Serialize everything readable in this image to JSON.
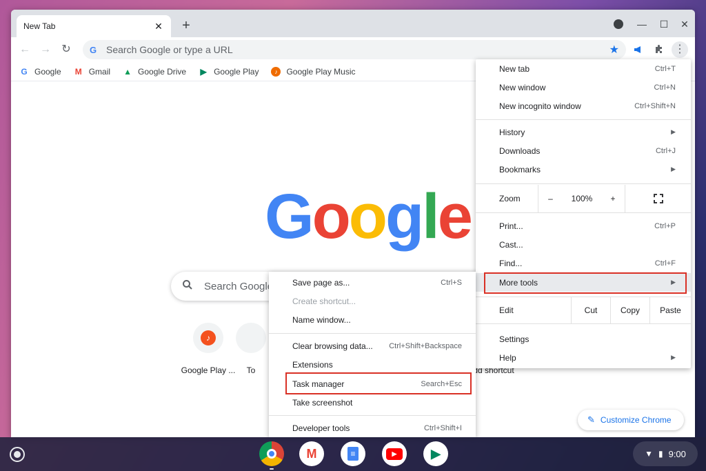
{
  "tab": {
    "title": "New Tab",
    "close": "✕"
  },
  "toolbar": {
    "new_tab": "+",
    "back": "←",
    "forward": "→",
    "reload": "↻",
    "omnibox_placeholder": "Search Google or type a URL",
    "star": "★",
    "announce": "📣",
    "extensions": "✚",
    "menu": "⋮"
  },
  "window_controls": {
    "minimize": "—",
    "maximize": "☐",
    "close": "✕"
  },
  "bookmarks": [
    {
      "label": "Google",
      "icon": "G",
      "color": "#4285f4"
    },
    {
      "label": "Gmail",
      "icon": "M",
      "color": "#ea4335"
    },
    {
      "label": "Google Drive",
      "icon": "▲",
      "color": "#0f9d58"
    },
    {
      "label": "Google Play",
      "icon": "▶",
      "color": "#01875f"
    },
    {
      "label": "Google Play Music",
      "icon": "♪",
      "color": "#ef6c00"
    }
  ],
  "ntp": {
    "logo": [
      "G",
      "o",
      "o",
      "g",
      "l",
      "e"
    ],
    "logo_colors": [
      "#4285f4",
      "#ea4335",
      "#fbbc05",
      "#4285f4",
      "#34a853",
      "#ea4335"
    ],
    "search_placeholder": "Search Google",
    "shortcuts": [
      {
        "label": "Google Play ..."
      },
      {
        "label": "To"
      },
      {
        "label": "Add shortcut"
      }
    ],
    "customize": "Customize Chrome"
  },
  "main_menu": {
    "new_tab": {
      "label": "New tab",
      "shortcut": "Ctrl+T"
    },
    "new_window": {
      "label": "New window",
      "shortcut": "Ctrl+N"
    },
    "incognito": {
      "label": "New incognito window",
      "shortcut": "Ctrl+Shift+N"
    },
    "history": {
      "label": "History"
    },
    "downloads": {
      "label": "Downloads",
      "shortcut": "Ctrl+J"
    },
    "bookmarks": {
      "label": "Bookmarks"
    },
    "zoom": {
      "label": "Zoom",
      "minus": "–",
      "level": "100%",
      "plus": "+",
      "fullscreen": "⛶"
    },
    "print": {
      "label": "Print...",
      "shortcut": "Ctrl+P"
    },
    "cast": {
      "label": "Cast..."
    },
    "find": {
      "label": "Find...",
      "shortcut": "Ctrl+F"
    },
    "more_tools": {
      "label": "More tools"
    },
    "edit": {
      "label": "Edit",
      "cut": "Cut",
      "copy": "Copy",
      "paste": "Paste"
    },
    "settings": {
      "label": "Settings"
    },
    "help": {
      "label": "Help"
    },
    "arrow": "▶"
  },
  "sub_menu": {
    "save_page": {
      "label": "Save page as...",
      "shortcut": "Ctrl+S"
    },
    "create_shortcut": {
      "label": "Create shortcut..."
    },
    "name_window": {
      "label": "Name window..."
    },
    "clear_data": {
      "label": "Clear browsing data...",
      "shortcut": "Ctrl+Shift+Backspace"
    },
    "extensions": {
      "label": "Extensions"
    },
    "task_manager": {
      "label": "Task manager",
      "shortcut": "Search+Esc"
    },
    "screenshot": {
      "label": "Take screenshot"
    },
    "dev_tools": {
      "label": "Developer tools",
      "shortcut": "Ctrl+Shift+I"
    }
  },
  "highlight_color": "#d93025",
  "shelf": {
    "apps": {
      "gmail": "M",
      "docs": "≡",
      "youtube": "▶",
      "play": "▶"
    },
    "wifi": "▼",
    "battery": "▮",
    "time": "9:00"
  }
}
